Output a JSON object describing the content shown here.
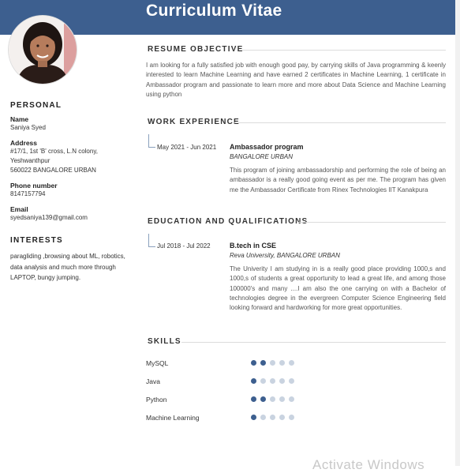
{
  "header": {
    "title": "Curriculum Vitae"
  },
  "sidebar": {
    "personal_heading": "PERSONAL",
    "name_label": "Name",
    "name_value": "Saniya Syed",
    "address_label": "Address",
    "address_line1": "#17/1, 1st 'B' cross, L.N colony,",
    "address_line2": "Yeshwanthpur",
    "address_line3": "560022 BANGALORE URBAN",
    "phone_label": "Phone number",
    "phone_value": "8147157794",
    "email_label": "Email",
    "email_value": "syedsaniya139@gmail.com",
    "interests_heading": "INTERESTS",
    "interests_text": "paragliding ,browsing about ML, robotics, data analysis and much more through LAPTOP, bungy jumping."
  },
  "objective": {
    "heading": "RESUME OBJECTIVE",
    "text": "I am looking for a fully satisfied job with enough good pay, by carrying skills of Java programming & keenly interested to learn Machine Learning and have earned 2 certificates in Machine Learning, 1 certificate in Ambassador program and passionate to learn more and more about Data Science and Machine Learning using python"
  },
  "experience": {
    "heading": "WORK EXPERIENCE",
    "items": [
      {
        "date": "May 2021 - Jun 2021",
        "title": "Ambassador program",
        "org": "BANGALORE URBAN",
        "description": "This program of joining ambassadorship and performing the role of being an ambassador is a really good going event as per me. The program has given me the Ambassador Certificate from Rinex Technologies IIT Kanakpura"
      }
    ]
  },
  "education": {
    "heading": "EDUCATION AND QUALIFICATIONS",
    "items": [
      {
        "date": "Jul 2018 - Jul 2022",
        "title": "B.tech in CSE",
        "org": "Reva University, BANGALORE URBAN",
        "description": "The Univerity I am studying in is a really good place providing 1000,s and 1000,s of students a great opportunity to lead a great life, and among those 100000's and many ....I am also the one carrying on with a Bachelor of technologies degree in the evergreen Computer Science Engineering field looking forward and hardworking for more great opportunities."
      }
    ]
  },
  "skills": {
    "heading": "SKILLS",
    "items": [
      {
        "name": "MySQL",
        "level": 2,
        "max": 5
      },
      {
        "name": "Java",
        "level": 1,
        "max": 5
      },
      {
        "name": "Python",
        "level": 2,
        "max": 5
      },
      {
        "name": "Machine Learning",
        "level": 1,
        "max": 5
      }
    ]
  },
  "watermark": "Activate Windows",
  "colors": {
    "accent": "#3d5f8f",
    "dot_inactive": "#c9d3e0"
  }
}
